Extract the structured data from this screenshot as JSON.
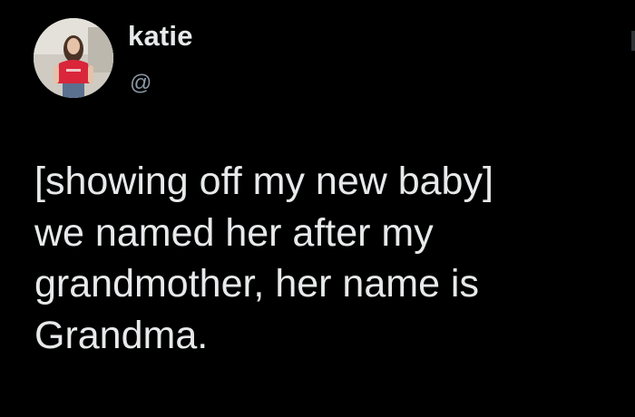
{
  "user": {
    "display_name": "katie",
    "handle": "@",
    "avatar": "profile-photo"
  },
  "tweet": {
    "text": "[showing off my new baby]\nwe named her after my\ngrandmother, her name is\nGrandma."
  },
  "colors": {
    "background": "#000000",
    "text": "#e7e9ea",
    "secondary_text": "#8b98a5",
    "avatar_shirt": "#d9263a"
  }
}
